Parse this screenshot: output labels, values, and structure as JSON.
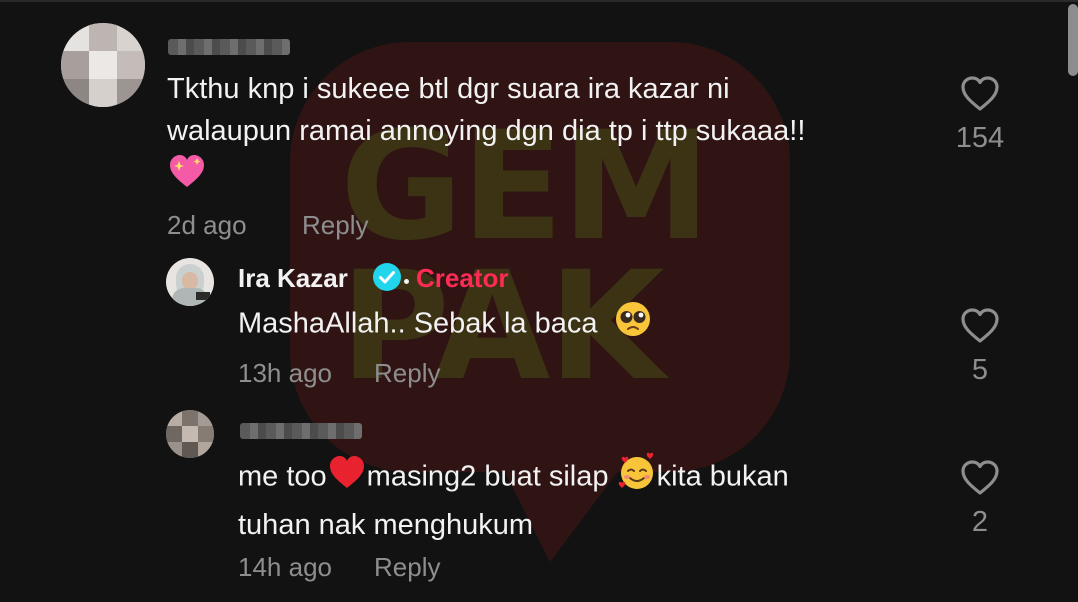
{
  "watermark": {
    "line1": "GEM",
    "line2": "PAK"
  },
  "comments": [
    {
      "text_line1": "Tkthu knp i sukeee btl dgr suara ira kazar ni",
      "text_line2": "walaupun ramai annoying dgn dia tp i ttp sukaaa!!",
      "emoji": "sparkling-heart",
      "time": "2d ago",
      "reply_label": "Reply",
      "likes": "154"
    },
    {
      "author": "Ira Kazar",
      "badge": "Creator",
      "text_line1": "MashaAllah.. Sebak la baca",
      "emoji": "pleading-face",
      "time": "13h ago",
      "reply_label": "Reply",
      "likes": "5"
    },
    {
      "text_part1": "me too",
      "text_part2": "masing2 buat silap",
      "text_part3": "kita bukan",
      "text_line2": "tuhan nak menghukum",
      "emoji1": "red-heart",
      "emoji2": "smiling-face-with-hearts",
      "time": "14h ago",
      "reply_label": "Reply",
      "likes": "2"
    }
  ],
  "colors": {
    "background": "#121212",
    "creator_badge": "#fe2c55",
    "verified": "#20d5ec",
    "muted_text": "#8e8e8e"
  }
}
